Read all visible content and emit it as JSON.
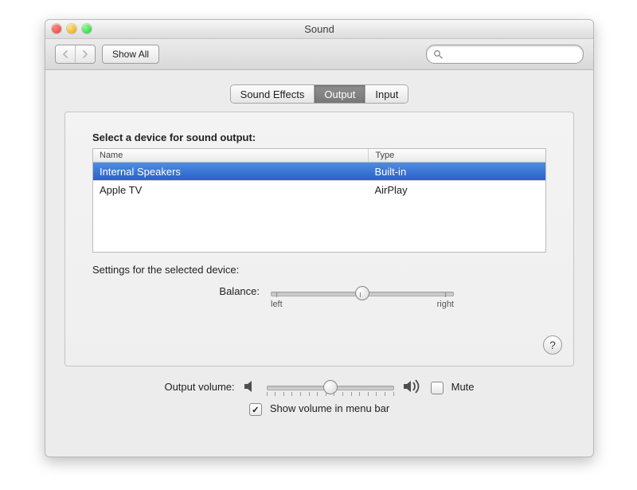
{
  "window": {
    "title": "Sound"
  },
  "toolbar": {
    "show_all": "Show All",
    "search_placeholder": ""
  },
  "tabs": [
    {
      "label": "Sound Effects",
      "active": false
    },
    {
      "label": "Output",
      "active": true
    },
    {
      "label": "Input",
      "active": false
    }
  ],
  "panel": {
    "heading": "Select a device for sound output:",
    "columns": {
      "name": "Name",
      "type": "Type"
    },
    "devices": [
      {
        "name": "Internal Speakers",
        "type": "Built-in",
        "selected": true
      },
      {
        "name": "Apple TV",
        "type": "AirPlay",
        "selected": false
      }
    ]
  },
  "settings": {
    "heading": "Settings for the selected device:",
    "balance_label": "Balance:",
    "balance_left": "left",
    "balance_right": "right",
    "balance_value": 0.5
  },
  "footer": {
    "volume_label": "Output volume:",
    "volume_value": 0.5,
    "mute_label": "Mute",
    "mute_checked": false,
    "show_menu_label": "Show volume in menu bar",
    "show_menu_checked": true
  },
  "help_label": "?"
}
